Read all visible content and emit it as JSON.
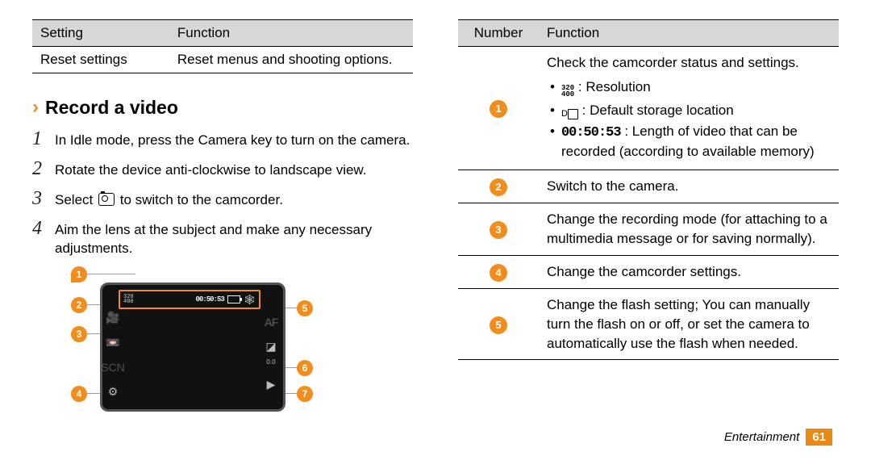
{
  "settingsTable": {
    "head": {
      "col1": "Setting",
      "col2": "Function"
    },
    "row": {
      "col1": "Reset settings",
      "col2": "Reset menus and shooting options."
    }
  },
  "section": {
    "title": "Record a video"
  },
  "steps": [
    {
      "n": "1",
      "text": "In Idle mode, press the Camera key to turn on the camera."
    },
    {
      "n": "2",
      "text": "Rotate the device anti-clockwise to landscape view."
    },
    {
      "n": "3",
      "before": "Select ",
      "after": " to switch to the camcorder."
    },
    {
      "n": "4",
      "text": "Aim the lens at the subject and make any necessary adjustments."
    }
  ],
  "figure": {
    "res": [
      "320",
      "400"
    ],
    "time": "00:50:53",
    "callouts": [
      "1",
      "2",
      "3",
      "4",
      "5",
      "6",
      "7"
    ]
  },
  "fnTable": {
    "head": {
      "col1": "Number",
      "col2": "Function"
    },
    "rows": [
      {
        "num": "1",
        "text": "Check the camcorder status and settings.",
        "bullets": [
          {
            "kind": "res",
            "label": ": Resolution",
            "res": [
              "320",
              "400"
            ]
          },
          {
            "kind": "storage",
            "label": ": Default storage location"
          },
          {
            "kind": "time",
            "time": "00:50:53",
            "label": ": Length of video that can be recorded (according to available memory)"
          }
        ]
      },
      {
        "num": "2",
        "text": "Switch to the camera."
      },
      {
        "num": "3",
        "text": "Change the recording mode (for attaching to a multimedia message or for saving normally)."
      },
      {
        "num": "4",
        "text": "Change the camcorder settings."
      },
      {
        "num": "5",
        "text": "Change the flash setting; You can manually turn the flash on or off, or set the camera to automatically use the flash when needed."
      }
    ]
  },
  "footer": {
    "section": "Entertainment",
    "page": "61"
  }
}
